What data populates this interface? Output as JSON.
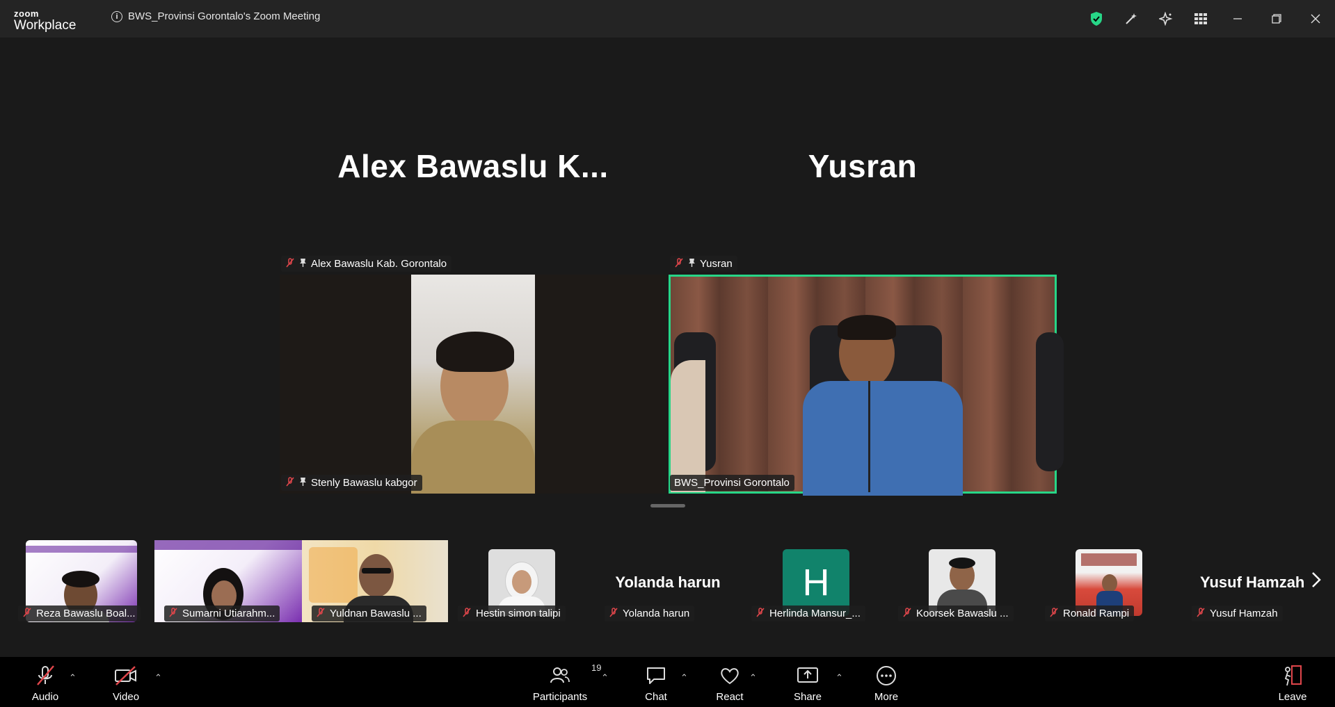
{
  "app": {
    "logo_top": "zoom",
    "logo_bottom": "Workplace",
    "meeting_title": "BWS_Provinsi Gorontalo's Zoom Meeting"
  },
  "stage": {
    "left": {
      "big_name": "Alex Bawaslu K...",
      "top_tag": "Alex Bawaslu Kab. Gorontalo",
      "bottom_tag": "Stenly Bawaslu kabgor"
    },
    "right": {
      "big_name": "Yusran",
      "top_tag": "Yusran",
      "bottom_tag": "BWS_Provinsi Gorontalo",
      "active_speaker_color": "#27d687"
    }
  },
  "strip": [
    {
      "name": "Reza Bawaslu Boal..."
    },
    {
      "name": "Sumarni Utiarahm..."
    },
    {
      "name": "Yuldnan Bawaslu ..."
    },
    {
      "name": "Hestin simon talipi"
    },
    {
      "name": "Yolanda harun",
      "big_label": "Yolanda harun"
    },
    {
      "name": "Herlinda Mansur_...",
      "avatar_letter": "H"
    },
    {
      "name": "Koorsek Bawaslu ..."
    },
    {
      "name": "Ronald Rampi"
    },
    {
      "name": "Yusuf Hamzah",
      "big_label": "Yusuf Hamzah"
    }
  ],
  "toolbar": {
    "audio": "Audio",
    "video": "Video",
    "participants": "Participants",
    "participants_count": "19",
    "chat": "Chat",
    "react": "React",
    "share": "Share",
    "more": "More",
    "leave": "Leave"
  },
  "icons": {
    "shield": "shield-check-icon",
    "accent_green": "#27d687",
    "mute_red": "#e0464b",
    "avatar_teal": "#11836b"
  }
}
